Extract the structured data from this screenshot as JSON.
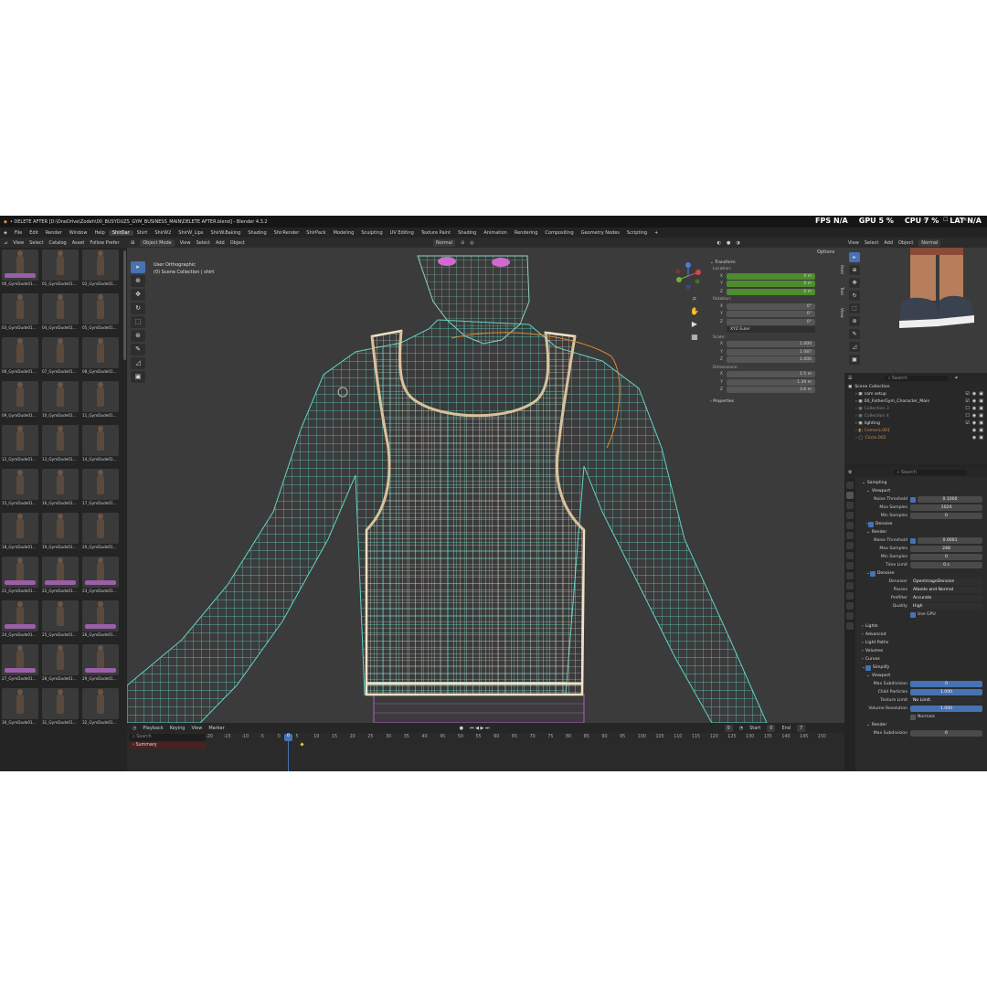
{
  "titlebar": {
    "text": "• DELETE AFTER [D:\\OneDrive\\Zodeh\\00_BUSYDUZS_GYM_BUSINESS_MAIN\\DELETE AFTER.blend] - Blender 4.3.2",
    "fps_label": "FPS",
    "fps_value": "N/A",
    "gpu_label": "GPU",
    "gpu_value": "5 %",
    "cpu_label": "CPU",
    "cpu_value": "7 %",
    "lat_label": "LAT",
    "lat_value": "N/A"
  },
  "menu": [
    "File",
    "Edit",
    "Render",
    "Window",
    "Help"
  ],
  "workspace_tabs": [
    "ShirDar",
    "Shirt",
    "ShirW2",
    "ShirW_Lips",
    "ShirW.Baking",
    "Shading",
    "ShirRender",
    "ShirPack",
    "Modeling",
    "Sculpting",
    "UV Editing",
    "Texture Paint",
    "Shading",
    "Animation",
    "Rendering",
    "Compositing",
    "Geometry Nodes",
    "Scripting"
  ],
  "asset_browser": {
    "header": [
      "View",
      "Select",
      "Catalog",
      "Asset",
      "Follow Prefer"
    ],
    "items": [
      "00_GymDude01...",
      "01_GymDude01...",
      "02_GymDude01...",
      "03_GymDude01...",
      "04_GymDude01...",
      "05_GymDude01...",
      "06_GymDude01...",
      "07_GymDude01...",
      "08_GymDude01...",
      "09_GymDude01...",
      "10_GymDude01...",
      "11_GymDude01...",
      "12_GymDude01...",
      "13_GymDude01...",
      "14_GymDude01...",
      "15_GymDude01...",
      "16_GymDude01...",
      "17_GymDude01...",
      "18_GymDude01...",
      "19_GymDude01...",
      "20_GymDude01...",
      "21_GymDude01...",
      "22_GymDude01...",
      "23_GymDude01...",
      "24_GymDude01...",
      "25_GymDude01...",
      "26_GymDude01...",
      "27_GymDude01...",
      "28_GymDude01...",
      "29_GymDude01...",
      "30_GymDude01...",
      "31_GymDude01...",
      "32_GymDude01..."
    ]
  },
  "viewport": {
    "mode": "Object Mode",
    "menus": [
      "View",
      "Select",
      "Add",
      "Object"
    ],
    "orientation": "Normal",
    "view_name": "User Orthographic",
    "collection_info": "(0) Scene Collection | shirt",
    "options": "Options",
    "transform": {
      "title": "Transform",
      "location_label": "Location:",
      "location": [
        {
          "axis": "X",
          "value": "0 m"
        },
        {
          "axis": "Y",
          "value": "0 m"
        },
        {
          "axis": "Z",
          "value": "0 m"
        }
      ],
      "rotation_label": "Rotation:",
      "rotation": [
        {
          "axis": "X",
          "value": "0°"
        },
        {
          "axis": "Y",
          "value": "0°"
        },
        {
          "axis": "Z",
          "value": "0°"
        }
      ],
      "rotation_mode": "XYZ Euler",
      "scale_label": "Scale:",
      "scale": [
        {
          "axis": "X",
          "value": "1.000"
        },
        {
          "axis": "Y",
          "value": "1.087"
        },
        {
          "axis": "Z",
          "value": "1.000"
        }
      ],
      "dimensions_label": "Dimensions:",
      "dimensions": [
        {
          "axis": "X",
          "value": "1.5 m"
        },
        {
          "axis": "Y",
          "value": "1.39 m"
        },
        {
          "axis": "Z",
          "value": "3.6 m"
        }
      ],
      "properties": "Properties"
    },
    "side_tabs": [
      "Item",
      "Tool",
      "View"
    ]
  },
  "timeline": {
    "menus": [
      "Playback",
      "Keying",
      "View",
      "Marker"
    ],
    "current_frame": "0",
    "current": "0",
    "start_label": "Start",
    "start": "0",
    "end_label": "End",
    "end": "7",
    "summary": "Summary",
    "search_placeholder": "Search",
    "ticks": [
      "-20",
      "-15",
      "-10",
      "-5",
      "0",
      "5",
      "10",
      "15",
      "20",
      "25",
      "30",
      "35",
      "40",
      "45",
      "50",
      "55",
      "60",
      "65",
      "70",
      "75",
      "80",
      "85",
      "90",
      "95",
      "100",
      "105",
      "110",
      "115",
      "120",
      "125",
      "130",
      "135",
      "140",
      "145",
      "150"
    ]
  },
  "right_viewport": {
    "menus": [
      "View",
      "Select",
      "Add",
      "Object"
    ],
    "orientation": "Normal"
  },
  "outliner": {
    "search_placeholder": "Search",
    "root": "Scene Collection",
    "items": [
      "cam setup",
      "00_FatherGym_Character_Main",
      "Collection 3",
      "Collection 4",
      "lighting",
      "Camera.001",
      "Circle.002"
    ]
  },
  "properties": {
    "search_placeholder": "Search",
    "sampling": "Sampling",
    "viewport_sect": "Viewport",
    "vp_noise_threshold_label": "Noise Threshold",
    "vp_noise_threshold": "0.1000",
    "vp_max_samples_label": "Max Samples",
    "vp_max_samples": "1024",
    "vp_min_samples_label": "Min Samples",
    "vp_min_samples": "0",
    "vp_denoise": "Denoise",
    "render_sect": "Render",
    "r_noise_threshold_label": "Noise Threshold",
    "r_noise_threshold": "0.0001",
    "r_max_samples_label": "Max Samples",
    "r_max_samples": "248",
    "r_min_samples_label": "Min Samples",
    "r_min_samples": "0",
    "r_time_limit_label": "Time Limit",
    "r_time_limit": "0 s",
    "r_denoise": "Denoise",
    "denoiser_label": "Denoiser",
    "denoiser": "OpenImageDenoise",
    "passes_label": "Passes",
    "passes": "Albedo and Normal",
    "prefilter_label": "Prefilter",
    "prefilter": "Accurate",
    "quality_label": "Quality",
    "quality": "High",
    "use_gpu": "Use GPU",
    "lights": "Lights",
    "advanced": "Advanced",
    "light_paths": "Light Paths",
    "volumes": "Volumes",
    "curves": "Curves",
    "simplify": "Simplify",
    "s_viewport": "Viewport",
    "max_subdiv_label": "Max Subdivision",
    "max_subdiv": "0",
    "child_particles_label": "Child Particles",
    "child_particles": "1.000",
    "texture_limit_label": "Texture Limit",
    "texture_limit": "No Limit",
    "volume_res_label": "Volume Resolution",
    "volume_res": "1.000",
    "normals": "Normals",
    "s_render": "Render",
    "r_max_subdiv_label": "Max Subdivision",
    "r_max_subdiv": "6"
  },
  "colors": {
    "accent": "#4772b3",
    "mesh_body": "#5fd3c4",
    "mesh_shirt": "#f2ead8",
    "location_field": "#4e8c2e"
  }
}
